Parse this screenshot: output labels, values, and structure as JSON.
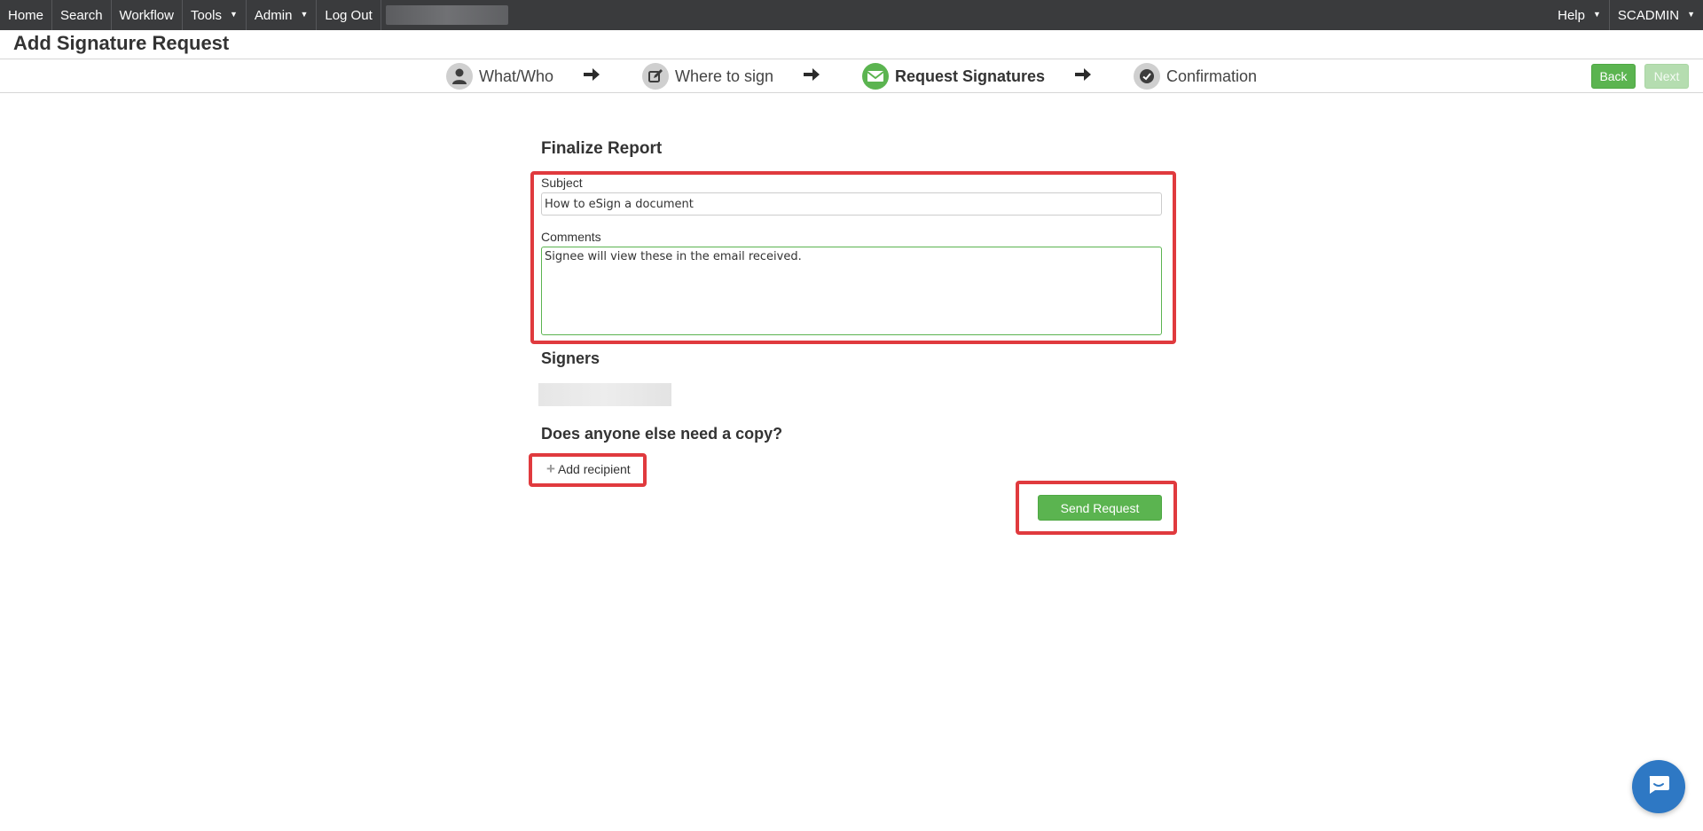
{
  "navbar": {
    "items": [
      "Home",
      "Search",
      "Workflow",
      "Tools",
      "Admin",
      "Log Out"
    ],
    "right_items": [
      "Help",
      "SCADMIN"
    ]
  },
  "page_title": "Add Signature Request",
  "wizard": {
    "steps": [
      {
        "label": "What/Who",
        "icon": "user-icon",
        "state": "completed"
      },
      {
        "label": "Where to sign",
        "icon": "edit-icon",
        "state": "completed"
      },
      {
        "label": "Request Signatures",
        "icon": "envelope-icon",
        "state": "active"
      },
      {
        "label": "Confirmation",
        "icon": "check-circle-icon",
        "state": "pending"
      }
    ],
    "back_label": "Back",
    "next_label": "Next"
  },
  "form": {
    "heading": "Finalize Report",
    "subject_label": "Subject",
    "subject_value": "How to eSign a document",
    "comments_label": "Comments",
    "comments_value": "Signee will view these in the email received.",
    "signers_heading": "Signers",
    "copy_heading": "Does anyone else need a copy?",
    "add_recipient_label": "Add recipient",
    "send_label": "Send Request"
  },
  "colors": {
    "navbar": "#3a3b3d",
    "accent_green": "#5bb450",
    "highlight_red": "#e03a3e",
    "chat_blue": "#2e78c4"
  }
}
